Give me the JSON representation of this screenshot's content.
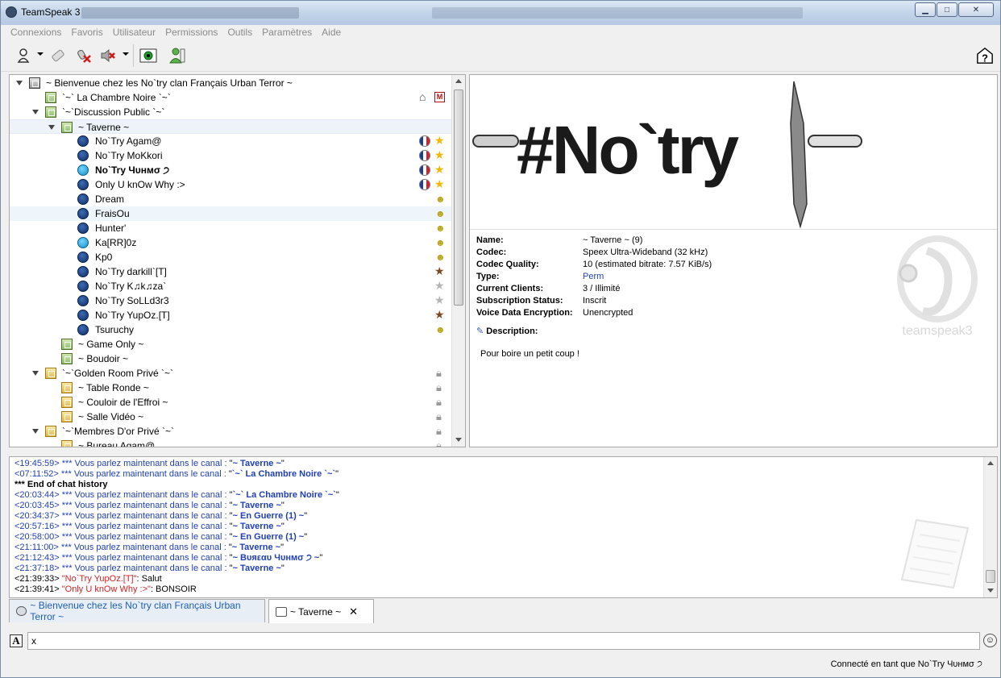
{
  "window": {
    "title": "TeamSpeak 3",
    "controls": [
      "minimize-icon",
      "maximize-icon",
      "close-icon"
    ]
  },
  "menu": [
    "Connexions",
    "Favoris",
    "Utilisateur",
    "Permissions",
    "Outils",
    "Paramètres",
    "Aide"
  ],
  "toolbar": {
    "buttons": [
      "connect-icon",
      "disconnect-icon",
      "mute-mic-icon",
      "mute-speaker-icon",
      "away-icon",
      "contact-icon"
    ],
    "help_icon": "help-icon"
  },
  "tree": {
    "server": {
      "label": "~ Bienvenue chez les No`try clan Français Urban Terror ~"
    },
    "rows": [
      {
        "label": "`~` La Chambre Noire `~`",
        "icon": "channel-green"
      },
      {
        "label": "`~`Discussion Public `~`",
        "icon": "channel-green"
      },
      {
        "label": "~ Taverne ~",
        "icon": "channel-green"
      },
      {
        "label": "No`Try  Agam@",
        "badge": "star-gold"
      },
      {
        "label": "No`Try MoKkori",
        "badge": "star-gold"
      },
      {
        "label": "No`Try Чυнмσ ੭",
        "badge": "star-gold"
      },
      {
        "label": "Only U knOw Why :>",
        "badge": "star-gold"
      },
      {
        "label": "Dream",
        "badge": "grin"
      },
      {
        "label": "FraisOu",
        "badge": "grin"
      },
      {
        "label": "Hunter'",
        "badge": "grin"
      },
      {
        "label": "Ka[RR]0z",
        "badge": "grin"
      },
      {
        "label": "Kp0",
        "badge": "grin"
      },
      {
        "label": "No`Try darkill`[T]",
        "badge": "star-brown"
      },
      {
        "label": "No`Try K♫k♫za`",
        "badge": "star-gray"
      },
      {
        "label": "No`Try SoLLd3r3",
        "badge": "star-gray"
      },
      {
        "label": "No`Try YupOz.[T]",
        "badge": "star-brown"
      },
      {
        "label": "Tsuruchy",
        "badge": "grin"
      },
      {
        "label": "~ Game Only ~",
        "icon": "channel-green"
      },
      {
        "label": "~  Boudoir ~",
        "icon": "channel-green"
      },
      {
        "label": "`~`Golden Room Privé `~`",
        "icon": "channel-gold"
      },
      {
        "label": "~ Table Ronde ~",
        "icon": "channel-gold"
      },
      {
        "label": "~ Couloir de l'Effroi ~",
        "icon": "channel-gold"
      },
      {
        "label": "~ Salle Vidéo ~",
        "icon": "channel-gold"
      },
      {
        "label": "`~`Membres D'or Privé `~`",
        "icon": "channel-gold"
      },
      {
        "label": "~ Bureau Agam@",
        "icon": "channel-gold"
      }
    ]
  },
  "info": {
    "banner_text": "#No`try",
    "props": [
      {
        "key": "Name:",
        "value": "~ Taverne ~ (9)"
      },
      {
        "key": "Codec:",
        "value": "Speex Ultra-Wideband (32 kHz)"
      },
      {
        "key": "Codec Quality:",
        "value": "10 (estimated bitrate: 7.57 KiB/s)"
      },
      {
        "key": "Type:",
        "value": "Perm"
      },
      {
        "key": "Current Clients:",
        "value": "3 / Illimité"
      },
      {
        "key": "Subscription Status:",
        "value": "Inscrit"
      },
      {
        "key": "Voice Data Encryption:",
        "value": "Unencrypted"
      }
    ],
    "description_title": "Description:",
    "description": "Pour boire un petit coup !",
    "logo_text": "teamspeak3"
  },
  "chat": {
    "sys_prefix": "*** Vous parlez maintenant dans le canal : ",
    "history_end": "*** End of chat history",
    "lines": [
      {
        "ts": "<19:45:59>",
        "channel": "~ Taverne ~"
      },
      {
        "ts": "<07:11:52>",
        "channel": "`~`  La Chambre Noire `~`"
      },
      {
        "ts": "<20:03:44>",
        "channel": "`~`  La Chambre Noire `~`"
      },
      {
        "ts": "<20:03:45>",
        "channel": "~ Taverne ~"
      },
      {
        "ts": "<20:34:37>",
        "channel": "~ En Guerre (1) ~"
      },
      {
        "ts": "<20:57:16>",
        "channel": "~ Taverne ~"
      },
      {
        "ts": "<20:58:00>",
        "channel": "~ En Guerre (1) ~"
      },
      {
        "ts": "<21:11:00>",
        "channel": "~ Taverne ~"
      },
      {
        "ts": "<21:12:43>",
        "channel": "~ Bυяεαυ Чυнмσ ੭ ~"
      },
      {
        "ts": "<21:37:18>",
        "channel": "~ Taverne ~"
      }
    ],
    "messages": [
      {
        "ts": "<21:39:33>",
        "nick": "\"No`Try YupOz.[T]\"",
        "text": ": Salut"
      },
      {
        "ts": "<21:39:41>",
        "nick": "\"Only U knOw Why :>\"",
        "text": ": BONSOIR"
      }
    ]
  },
  "tabs": [
    {
      "label": "~ Bienvenue chez les No`try clan Français Urban Terror ~"
    },
    {
      "label": "~ Taverne ~"
    }
  ],
  "input": {
    "value": "x"
  },
  "status": {
    "text": "Connecté en tant que No`Try Чυнмσ ੭"
  },
  "colors": {
    "link": "#1f3fb3",
    "nick": "#d42121",
    "accent": "#1a8fd8"
  }
}
